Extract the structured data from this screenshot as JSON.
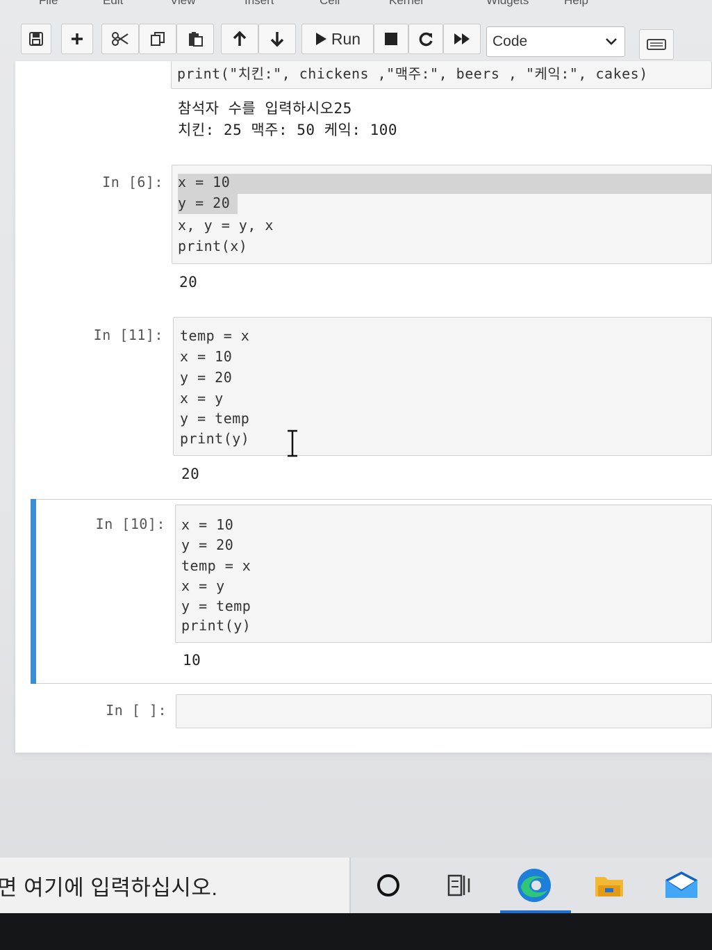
{
  "menu": {
    "items": [
      "File",
      "Edit",
      "View",
      "Insert",
      "Cell",
      "Kernel",
      "Widgets",
      "Help"
    ]
  },
  "toolbar": {
    "save_icon": "floppy-disk-icon",
    "add_icon": "plus-icon",
    "cut_icon": "scissors-icon",
    "copy_icon": "copy-icon",
    "paste_icon": "clipboard-icon",
    "move_up_icon": "arrow-up-icon",
    "move_down_icon": "arrow-down-icon",
    "run_label": "Run",
    "interrupt_icon": "stop-icon",
    "restart_icon": "restart-icon",
    "run_all_icon": "fast-forward-icon",
    "cell_type": "Code",
    "palette_icon": "keyboard-icon"
  },
  "cells": {
    "c0": {
      "code_tail": "print(\"치킨:\", chickens ,\"맥주:\", beers , \"케익:\", cakes)",
      "output": [
        "참석자 수를 입력하시오25",
        "치킨: 25 맥주: 50 케익: 100"
      ]
    },
    "c1": {
      "prompt": "In [6]:",
      "code": [
        "x = 10",
        "y = 20",
        "x, y = y, x",
        "print(x)"
      ],
      "output": "20"
    },
    "c2": {
      "prompt": "In [11]:",
      "code": [
        "temp = x",
        "x = 10",
        "y = 20",
        "x = y",
        "y = temp",
        "print(y)"
      ],
      "output": "20"
    },
    "c3": {
      "prompt": "In [10]:",
      "code": [
        "x = 10",
        "y = 20",
        "temp = x",
        "x = y",
        "y = temp",
        "print(y)"
      ],
      "output": "10"
    },
    "c4": {
      "prompt": "In [ ]:"
    }
  },
  "taskbar": {
    "search_placeholder": "면 여기에 입력하십시오.",
    "icons": [
      "cortana-icon",
      "task-view-icon",
      "edge-icon",
      "file-explorer-icon",
      "mail-icon"
    ]
  }
}
